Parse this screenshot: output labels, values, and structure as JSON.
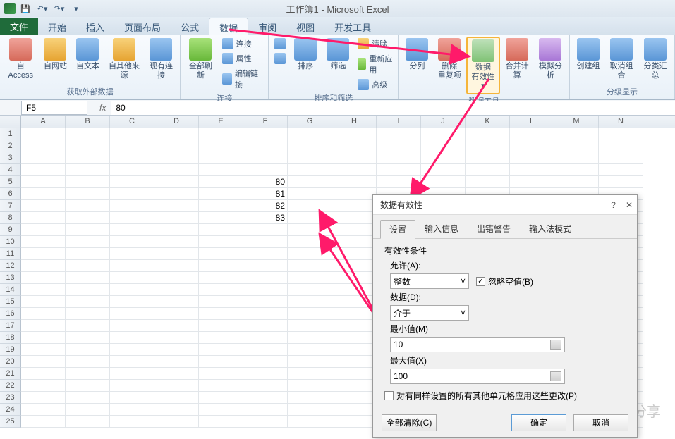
{
  "app": {
    "title": "工作簿1 - Microsoft Excel"
  },
  "qat": {
    "save": "保存",
    "undo": "撤销",
    "redo": "恢复"
  },
  "tabs": {
    "file": "文件",
    "home": "开始",
    "insert": "插入",
    "layout": "页面布局",
    "formula": "公式",
    "data": "数据",
    "review": "审阅",
    "view": "视图",
    "dev": "开发工具"
  },
  "ribbon": {
    "groups": {
      "ext": {
        "label": "获取外部数据",
        "access": "自 Access",
        "web": "自网站",
        "text": "自文本",
        "other": "自其他来源",
        "conn": "现有连接"
      },
      "conn": {
        "label": "连接",
        "refresh": "全部刷新",
        "connections": "连接",
        "property": "属性",
        "edit_links": "编辑链接"
      },
      "sort": {
        "label": "排序和筛选",
        "sort": "排序",
        "filter": "筛选",
        "clear": "清除",
        "reapply": "重新应用",
        "advanced": "高级"
      },
      "tools": {
        "label": "数据工具",
        "ttc": "分列",
        "dedup_l1": "删除",
        "dedup_l2": "重复项",
        "dv_l1": "数据",
        "dv_l2": "有效性",
        "consol": "合并计算",
        "whatif": "模拟分析"
      },
      "outline": {
        "label": "分级显示",
        "group": "创建组",
        "ungroup": "取消组合",
        "subtotal": "分类汇总"
      }
    }
  },
  "formula_bar": {
    "name_box": "F5",
    "fx": "fx",
    "formula": "80"
  },
  "grid": {
    "cols": [
      "A",
      "B",
      "C",
      "D",
      "E",
      "F",
      "G",
      "H",
      "I",
      "J",
      "K",
      "L",
      "M",
      "N"
    ],
    "row_count": 25,
    "cells": {
      "F5": "80",
      "F6": "81",
      "F7": "82",
      "F8": "83"
    }
  },
  "dialog": {
    "title": "数据有效性",
    "tabs": {
      "settings": "设置",
      "input": "输入信息",
      "error": "出错警告",
      "ime": "输入法模式"
    },
    "settings": {
      "criteria_label": "有效性条件",
      "allow_label": "允许(A):",
      "allow_value": "整数",
      "ignore_blank": "忽略空值(B)",
      "data_label": "数据(D):",
      "data_value": "介于",
      "min_label": "最小值(M)",
      "min_value": "10",
      "max_label": "最大值(X)",
      "max_value": "100",
      "apply_all": "对有同样设置的所有其他单元格应用这些更改(P)"
    },
    "footer": {
      "clear": "全部清除(C)",
      "ok": "确定",
      "cancel": "取消"
    }
  },
  "watermark": {
    "text": "@欣辰科技分享"
  }
}
